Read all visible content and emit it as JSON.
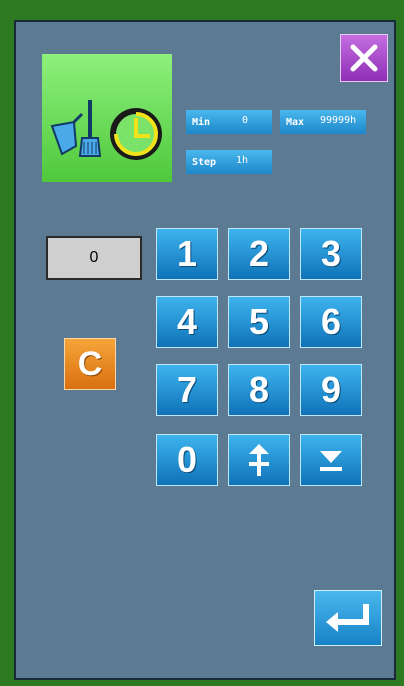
{
  "dialog": {
    "close_icon": "close-icon",
    "function_icon": "broom-and-clock-icon"
  },
  "params": {
    "min_label": "Min",
    "min_value": "0",
    "max_label": "Max",
    "max_value": "99999h",
    "step_label": "Step",
    "step_value": "1h"
  },
  "input": {
    "value": "0"
  },
  "keypad": {
    "clear_label": "C",
    "keys": [
      "1",
      "2",
      "3",
      "4",
      "5",
      "6",
      "7",
      "8",
      "9",
      "0"
    ],
    "increment_icon": "plus-up-arrow-icon",
    "decrement_icon": "down-arrow-icon",
    "enter_icon": "enter-icon"
  },
  "colors": {
    "background": "#5c7b92",
    "key_blue": "#1d86c9",
    "clear_orange": "#d9700f",
    "close_purple": "#8e2fb6",
    "icon_green": "#4fc83c"
  }
}
